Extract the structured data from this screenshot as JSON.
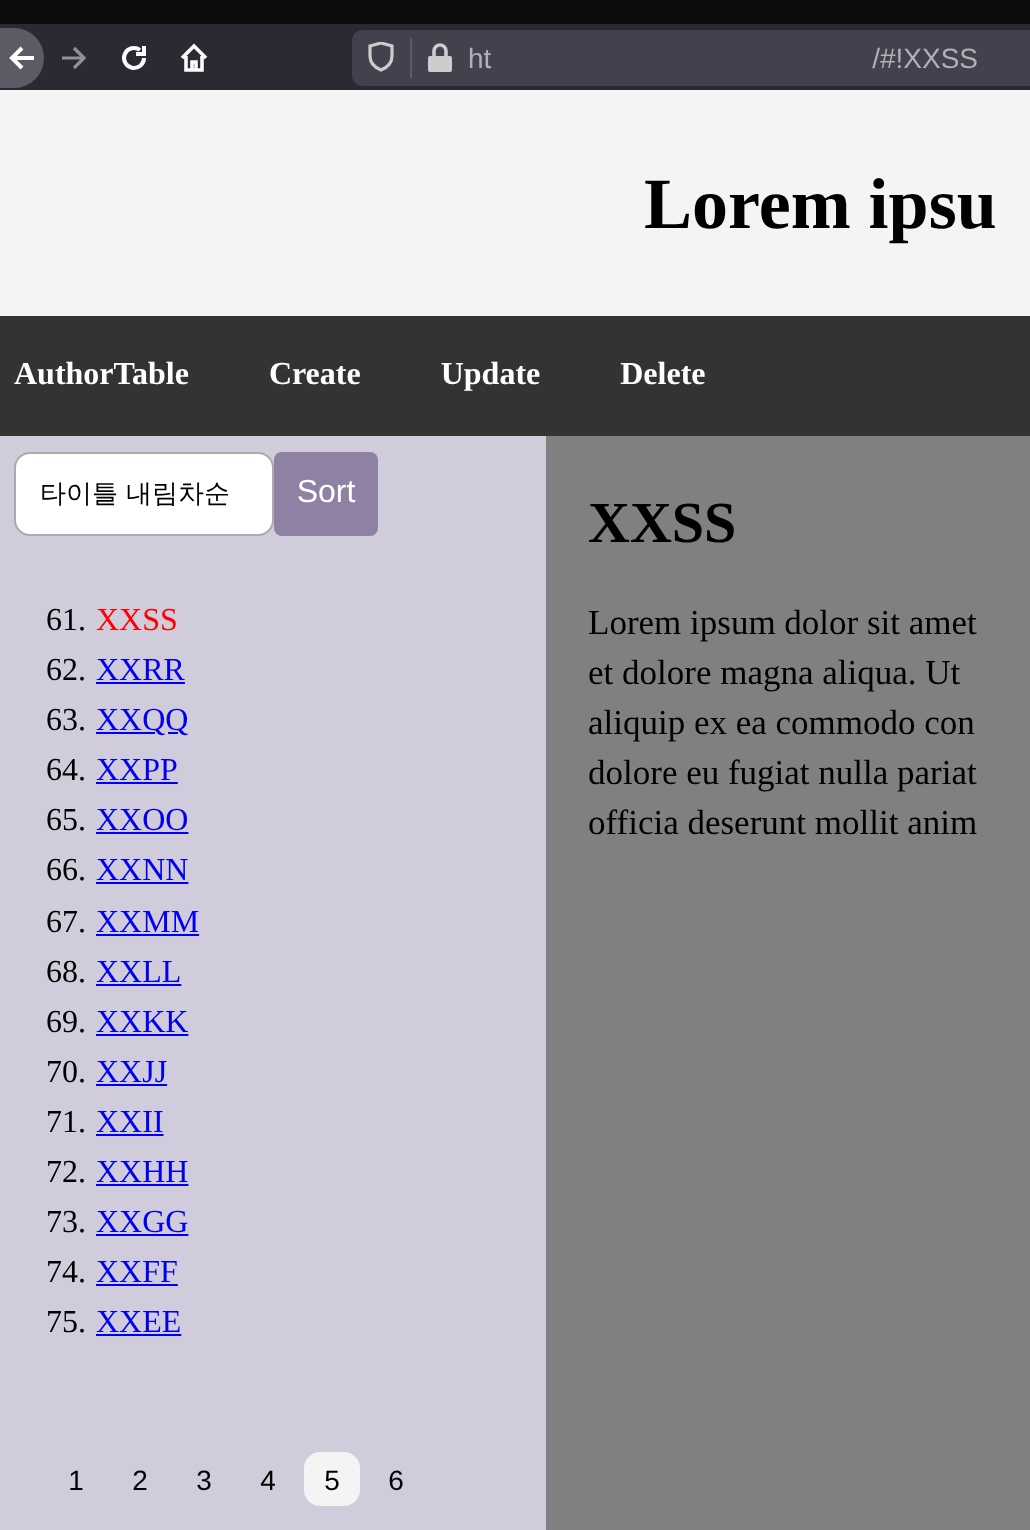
{
  "browser": {
    "url_start": "ht",
    "url_end": "/#!XXSS"
  },
  "header": {
    "title": "Lorem ipsu"
  },
  "nav": [
    "AuthorTable",
    "Create",
    "Update",
    "Delete"
  ],
  "sidebar": {
    "sort_field": {
      "value": "타이틀 내림차순"
    },
    "sort_button": "Sort",
    "items": [
      {
        "number": "61.",
        "label": "XXSS",
        "selected": true
      },
      {
        "number": "62.",
        "label": "XXRR",
        "selected": false
      },
      {
        "number": "63.",
        "label": "XXQQ",
        "selected": false
      },
      {
        "number": "64.",
        "label": "XXPP",
        "selected": false
      },
      {
        "number": "65.",
        "label": "XXOO",
        "selected": false
      },
      {
        "number": "66.",
        "label": "XXNN",
        "selected": false
      },
      {
        "number": "67.",
        "label": "XXMM",
        "selected": false
      },
      {
        "number": "68.",
        "label": "XXLL",
        "selected": false
      },
      {
        "number": "69.",
        "label": "XXKK",
        "selected": false
      },
      {
        "number": "70.",
        "label": "XXJJ",
        "selected": false
      },
      {
        "number": "71.",
        "label": "XXII",
        "selected": false
      },
      {
        "number": "72.",
        "label": "XXHH",
        "selected": false
      },
      {
        "number": "73.",
        "label": "XXGG",
        "selected": false
      },
      {
        "number": "74.",
        "label": "XXFF",
        "selected": false
      },
      {
        "number": "75.",
        "label": "XXEE",
        "selected": false
      }
    ],
    "pages": [
      {
        "label": "1",
        "selected": false
      },
      {
        "label": "2",
        "selected": false
      },
      {
        "label": "3",
        "selected": false
      },
      {
        "label": "4",
        "selected": false
      },
      {
        "label": "5",
        "selected": true
      },
      {
        "label": "6",
        "selected": false
      }
    ]
  },
  "content": {
    "heading": "XXSS",
    "lines": [
      "Lorem ipsum dolor sit amet",
      "et dolore magna aliqua. Ut",
      "aliquip ex ea commodo con",
      "dolore eu fugiat nulla pariat",
      "officia deserunt mollit anim"
    ]
  }
}
